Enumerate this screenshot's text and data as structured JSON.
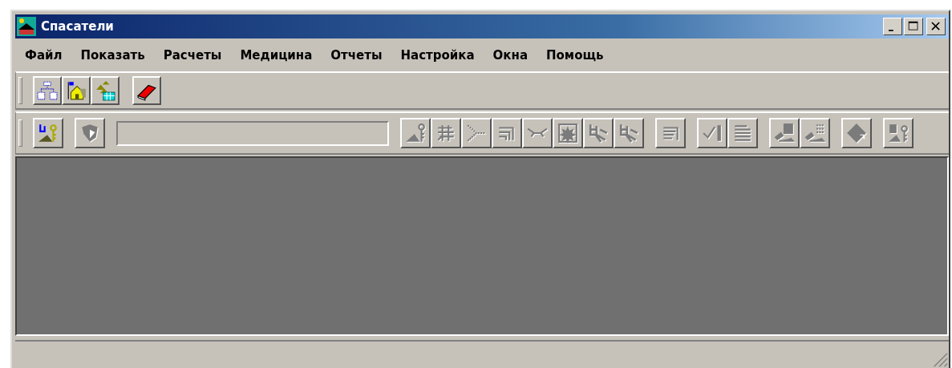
{
  "window": {
    "title": "Спасатели"
  },
  "menu": [
    {
      "label": "Файл"
    },
    {
      "label": "Показать"
    },
    {
      "label": "Расчеты"
    },
    {
      "label": "Медицина"
    },
    {
      "label": "Отчеты"
    },
    {
      "label": "Настройка"
    },
    {
      "label": "Окна"
    },
    {
      "label": "Помощь"
    }
  ],
  "toolbar_1": {
    "groups": [
      [
        {
          "kind": "tree",
          "disabled": false
        },
        {
          "kind": "house",
          "disabled": false
        },
        {
          "kind": "camp",
          "disabled": false
        }
      ],
      [
        {
          "kind": "book",
          "disabled": false
        }
      ]
    ]
  },
  "toolbar_2": {
    "groups": [
      [
        {
          "kind": "keymap",
          "disabled": false
        }
      ],
      [
        {
          "kind": "shield",
          "disabled": true
        }
      ],
      [
        {
          "kind": "field"
        }
      ],
      [
        {
          "kind": "peak",
          "disabled": true
        },
        {
          "kind": "hatch",
          "disabled": true
        },
        {
          "kind": "fork",
          "disabled": true
        },
        {
          "kind": "steps",
          "disabled": true
        },
        {
          "kind": "link",
          "disabled": true
        },
        {
          "kind": "burst",
          "disabled": true
        },
        {
          "kind": "figure",
          "disabled": true
        },
        {
          "kind": "figure",
          "disabled": true
        }
      ],
      [
        {
          "kind": "lines",
          "disabled": true
        }
      ],
      [
        {
          "kind": "check",
          "disabled": true
        },
        {
          "kind": "list",
          "disabled": true
        }
      ],
      [
        {
          "kind": "export",
          "disabled": true
        },
        {
          "kind": "exportlist",
          "disabled": true
        }
      ],
      [
        {
          "kind": "diamond",
          "disabled": true
        }
      ],
      [
        {
          "kind": "pagekey",
          "disabled": true
        }
      ]
    ]
  }
}
